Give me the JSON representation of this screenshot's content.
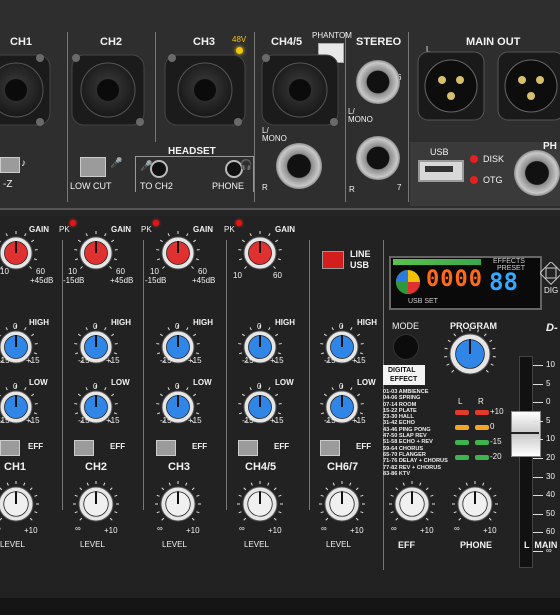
{
  "top": {
    "channels": [
      "CH1",
      "CH2",
      "CH3",
      "CH4/5",
      "STEREO",
      "MAIN OUT"
    ],
    "v48": "48V",
    "phantom": "PHANTOM",
    "hiz_suffix": "-Z",
    "low_cut": "LOW CUT",
    "headset": "HEADSET",
    "to_ch2": "TO CH2",
    "phone": "PHONE",
    "l_mono": "L/\nMONO",
    "r": "R",
    "l": "L",
    "six": "6",
    "seven": "7",
    "usb": "USB",
    "disk": "DISK",
    "otg": "OTG",
    "ph_partial": "PH"
  },
  "channels": [
    {
      "name": "CH1",
      "gain_lo": "10",
      "gain_hi": "60",
      "gain_db_lo": "",
      "gain_db_hi": "+45dB"
    },
    {
      "name": "CH2",
      "gain_lo": "10",
      "gain_hi": "60",
      "gain_db_lo": "-15dB",
      "gain_db_hi": "+45dB"
    },
    {
      "name": "CH3",
      "gain_lo": "10",
      "gain_hi": "60",
      "gain_db_lo": "-15dB",
      "gain_db_hi": "+45dB"
    },
    {
      "name": "CH4/5",
      "gain_lo": "10",
      "gain_hi": "60",
      "gain_db_lo": "",
      "gain_db_hi": ""
    },
    {
      "name": "CH6/7",
      "gain_lo": "",
      "gain_hi": "",
      "gain_db_lo": "",
      "gain_db_hi": ""
    }
  ],
  "knob_labels": {
    "gain": "GAIN",
    "high": "HIGH",
    "low": "LOW",
    "eff": "EFF",
    "pk": "PK",
    "zero": "0",
    "minus15": "-15",
    "plus15": "+15",
    "inf": "∞",
    "plus10": "+10",
    "level": "LEVEL"
  },
  "line_usb": {
    "line": "LINE",
    "usb": "USB"
  },
  "display": {
    "effects": "EFFECTS",
    "preset": "PRESET",
    "digits": "0000",
    "preset_digits": "88",
    "usb_set": "USB SET"
  },
  "mode": "MODE",
  "program": "PROGRAM",
  "digital": "DIGITAL",
  "effect": "EFFECT",
  "effects_list": [
    "01-03 AMBIENCE",
    "04-06 SPRING",
    "07-14 ROOM",
    "15-22 PLATE",
    "23-30 HALL",
    "31-42 ECHO",
    "43-46 PING PONG",
    "47-50 SLAP REV",
    "51-58 ECHO + REV",
    "59-64 CHORUS",
    "65-70 FLANGER",
    "71-76 DELAY + CHORUS",
    "77-82 REV + CHORUS",
    "83-86 KTV"
  ],
  "meter": {
    "l": "L",
    "r": "R",
    "levels": [
      "+10",
      "0",
      "-15",
      "-20"
    ],
    "led_colors": [
      "#e33b2b",
      "#f2a623",
      "#3fb34f",
      "#3fb34f"
    ]
  },
  "fader_scale": [
    "10",
    "5",
    "0",
    "5",
    "10",
    "20",
    "30",
    "40",
    "50",
    "60",
    "∞"
  ],
  "bottom": {
    "eff": "EFF",
    "phone": "PHONE",
    "main": "L  MAIN"
  },
  "brand_partial": {
    "dig": "DIG",
    "d": "D-"
  },
  "colors": {
    "panel": "#2e2e2e",
    "gain_knob": "#e03030",
    "eq_knob": "#2f86e6",
    "level_knob": "#f0f0f0"
  }
}
